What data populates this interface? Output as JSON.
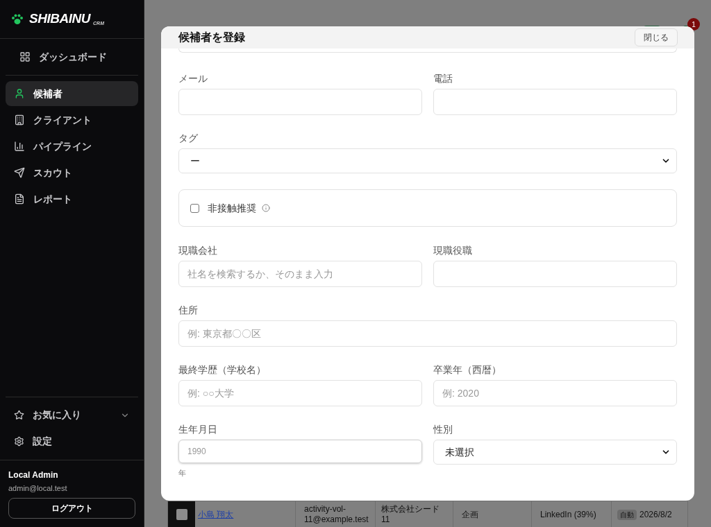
{
  "sidebar": {
    "logo": {
      "name": "SHIBAINU",
      "suffix": "CRM"
    },
    "top_items": [
      {
        "label": "ダッシュボード",
        "selected": false
      }
    ],
    "items": [
      {
        "label": "候補者",
        "selected": true
      },
      {
        "label": "クライアント",
        "selected": false
      },
      {
        "label": "パイプライン",
        "selected": false
      },
      {
        "label": "スカウト",
        "selected": false
      },
      {
        "label": "レポート",
        "selected": false
      }
    ],
    "bottom_items": [
      {
        "label": "お気に入り",
        "expanded": false
      },
      {
        "label": "設定"
      }
    ],
    "user": {
      "name": "Local Admin",
      "email": "admin@local.test",
      "logout": "ログアウト"
    }
  },
  "header": {
    "notification_count": "1"
  },
  "background_row": {
    "checked": false,
    "name": "小島 翔太",
    "email": "activity-vol-11@example.test",
    "company": "株式会社シード 11",
    "role": "企画",
    "source": "LinkedIn (39%)",
    "badge": "自動",
    "date": "2026/8/2"
  },
  "modal": {
    "title": "候補者を登録",
    "close": "閉じる",
    "rows": [
      [
        {
          "kind": "input",
          "label": "メール"
        },
        {
          "kind": "input",
          "label": "電話"
        }
      ],
      [
        {
          "kind": "select",
          "label": "タグ",
          "value": "ー"
        }
      ],
      [
        {
          "kind": "checkbox",
          "label": "非接触推奨",
          "checked": false
        }
      ],
      [
        {
          "kind": "input",
          "label": "現職会社",
          "placeholder": "社名を検索するか、そのまま入力"
        },
        {
          "kind": "input",
          "label": "現職役職"
        }
      ],
      [
        {
          "kind": "input",
          "label": "住所",
          "placeholder": "例: 東京都〇〇区"
        }
      ],
      [
        {
          "kind": "input",
          "label": "最終学歴（学校名）",
          "placeholder": "例: ○○大学"
        },
        {
          "kind": "input",
          "label": "卒業年（西暦）",
          "placeholder": "例: 2020"
        }
      ],
      [
        {
          "kind": "year",
          "label": "生年月日",
          "placeholder": "1990",
          "unit": "年"
        },
        {
          "kind": "select",
          "label": "性別",
          "value": "未選択"
        }
      ]
    ]
  }
}
